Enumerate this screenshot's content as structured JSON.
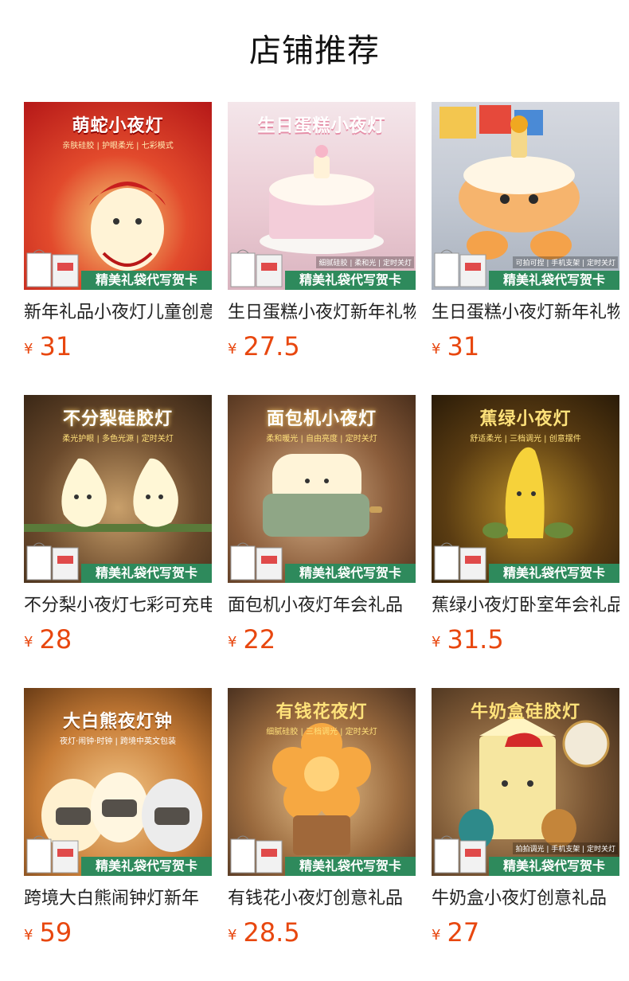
{
  "header": {
    "title": "店铺推荐"
  },
  "colors": {
    "price": "#e8470f",
    "gift_banner": "#2e8a5c"
  },
  "products": [
    {
      "thumb_title": "萌蛇小夜灯",
      "thumb_sub": "亲肤硅胶 | 护眼柔光 | 七彩模式",
      "thumb_note": "",
      "gift_banner": "精美礼袋代写贺卡",
      "name": "新年礼品小夜灯儿童创意",
      "currency": "¥",
      "price": "31"
    },
    {
      "thumb_title": "生日蛋糕小夜灯",
      "thumb_sub": "",
      "thumb_note": "细腻硅胶 | 柔和光 | 定时关灯",
      "gift_banner": "精美礼袋代写贺卡",
      "name": "生日蛋糕小夜灯新年礼物",
      "currency": "¥",
      "price": "27.5"
    },
    {
      "thumb_title": "",
      "thumb_sub": "",
      "thumb_note": "可拍可捏 | 手机支架 | 定时关灯",
      "gift_banner": "精美礼袋代写贺卡",
      "name": "生日蛋糕小夜灯新年礼物",
      "currency": "¥",
      "price": "31"
    },
    {
      "thumb_title": "不分梨硅胶灯",
      "thumb_sub": "柔光护眼 | 多色光源 | 定时关灯",
      "thumb_note": "",
      "gift_banner": "精美礼袋代写贺卡",
      "name": "不分梨小夜灯七彩可充电",
      "currency": "¥",
      "price": "28"
    },
    {
      "thumb_title": "面包机小夜灯",
      "thumb_sub": "柔和暖光 | 自由亮度 | 定时关灯",
      "thumb_note": "",
      "gift_banner": "精美礼袋代写贺卡",
      "name": "面包机小夜灯年会礼品",
      "currency": "¥",
      "price": "22"
    },
    {
      "thumb_title": "蕉绿小夜灯",
      "thumb_sub": "舒适柔光 | 三档调光 | 创意摆件",
      "thumb_note": "",
      "gift_banner": "精美礼袋代写贺卡",
      "name": "蕉绿小夜灯卧室年会礼品",
      "currency": "¥",
      "price": "31.5"
    },
    {
      "thumb_title": "大白熊夜灯钟",
      "thumb_sub": "夜灯·闹钟·时钟 | 跨境中英文包装",
      "thumb_note": "",
      "gift_banner": "精美礼袋代写贺卡",
      "name": "跨境大白熊闹钟灯新年",
      "currency": "¥",
      "price": "59"
    },
    {
      "thumb_title": "有钱花夜灯",
      "thumb_sub": "细腻硅胶 | 三档调光 | 定时关灯",
      "thumb_note": "",
      "gift_banner": "精美礼袋代写贺卡",
      "name": "有钱花小夜灯创意礼品",
      "currency": "¥",
      "price": "28.5"
    },
    {
      "thumb_title": "牛奶盒硅胶灯",
      "thumb_sub": "",
      "thumb_note": "拍拍调光 | 手机支架 | 定时关灯",
      "gift_banner": "精美礼袋代写贺卡",
      "name": "牛奶盒小夜灯创意礼品",
      "currency": "¥",
      "price": "27"
    }
  ]
}
